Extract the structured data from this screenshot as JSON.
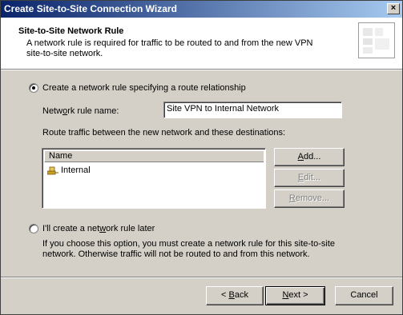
{
  "window": {
    "title": "Create Site-to-Site Connection Wizard",
    "close_glyph": "×"
  },
  "header": {
    "title": "Site-to-Site Network Rule",
    "subtitle": "A network rule is required for traffic to be routed to and from the new VPN site-to-site network."
  },
  "option_create": {
    "label_pre": "Create a network rule specifying a route relationship",
    "selected": true
  },
  "rule_name": {
    "label_pre": "Netw",
    "label_u": "o",
    "label_post": "rk rule name:",
    "value": "Site VPN to Internal Network"
  },
  "destinations": {
    "label": "Route traffic between the new network and these destinations:",
    "column_header": "Name",
    "items": [
      {
        "label": "Internal",
        "icon": "network-icon"
      }
    ]
  },
  "buttons": {
    "add": {
      "u": "A",
      "rest": "dd..."
    },
    "edit": {
      "u": "E",
      "rest": "dit..."
    },
    "remove": {
      "u": "R",
      "rest": "emove..."
    },
    "back": {
      "pre": "< ",
      "u": "B",
      "rest": "ack"
    },
    "next": {
      "u": "N",
      "rest": "ext >"
    },
    "cancel": {
      "label": "Cancel"
    }
  },
  "option_later": {
    "label_pre": "I'll create a net",
    "label_u": "w",
    "label_post": "ork rule later",
    "selected": false,
    "description": "If you choose this option, you must create a network rule for this site-to-site network. Otherwise traffic will not be routed to and from this network."
  }
}
